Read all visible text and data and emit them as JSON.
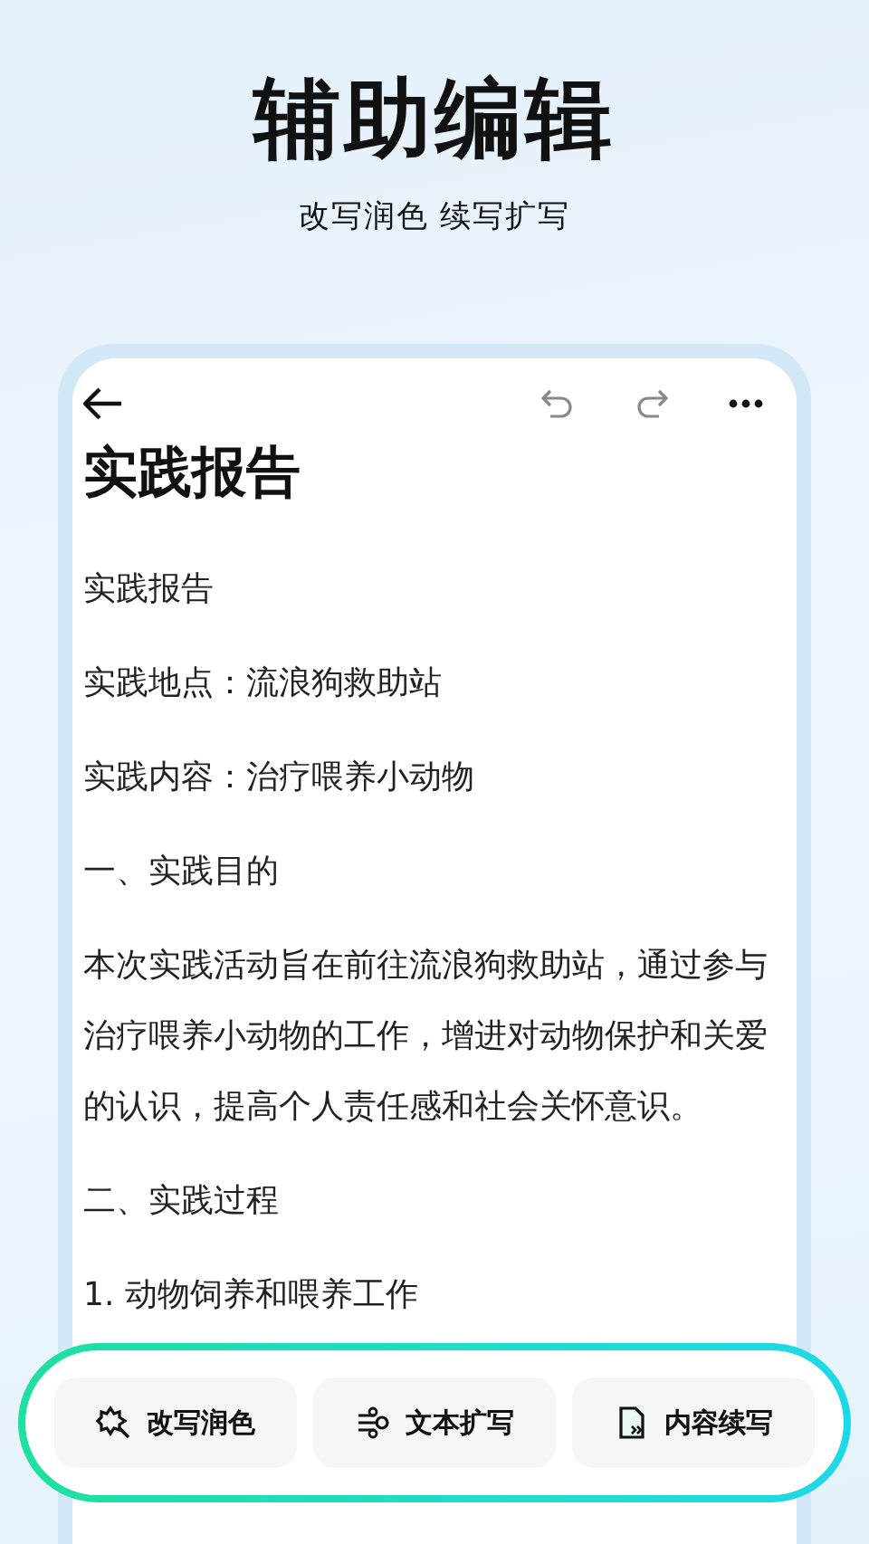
{
  "header": {
    "title": "辅助编辑",
    "subtitle": "改写润色 续写扩写"
  },
  "document": {
    "title": "实践报告",
    "paragraphs": [
      "实践报告",
      "实践地点：流浪狗救助站",
      "实践内容：治疗喂养小动物",
      "一、实践目的",
      "本次实践活动旨在前往流浪狗救助站，通过参与治疗喂养小动物的工作，增进对动物保护和关爱的认识，提高个人责任感和社会关怀意识。",
      "二、实践过程",
      "1. 动物饲养和喂养工作"
    ]
  },
  "actions": [
    {
      "kind": "polish",
      "label": "改写润色"
    },
    {
      "kind": "expand",
      "label": "文本扩写"
    },
    {
      "kind": "continue",
      "label": "内容续写"
    }
  ]
}
